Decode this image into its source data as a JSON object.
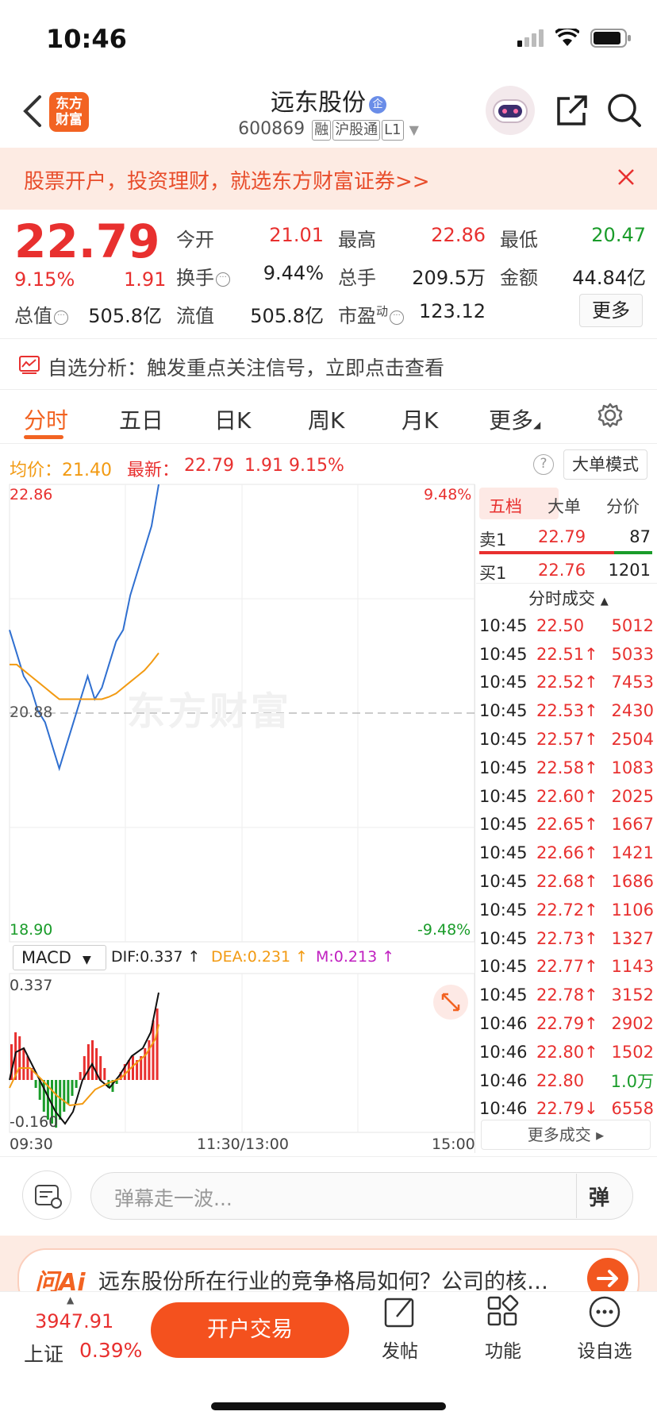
{
  "status": {
    "time": "10:46"
  },
  "header": {
    "logo_line1": "东方",
    "logo_line2": "财富",
    "title": "远东股份",
    "title_badge": "企",
    "code": "600869",
    "tags": [
      "融",
      "沪股通",
      "L1"
    ]
  },
  "banner": {
    "text": "股票开户，投资理财，就选东方财富证券>>"
  },
  "quote": {
    "price": "22.79",
    "pct": "9.15%",
    "change": "1.91",
    "open_label": "今开",
    "open": "21.01",
    "high_label": "最高",
    "high": "22.86",
    "low_label": "最低",
    "low": "20.47",
    "turnover_label": "换手",
    "turnover": "9.44%",
    "volume_label": "总手",
    "volume": "209.5万",
    "amount_label": "金额",
    "amount": "44.84亿",
    "mcap_label": "总值",
    "mcap": "505.8亿",
    "float_label": "流值",
    "float": "505.8亿",
    "pe_label": "市盈",
    "pe_sup": "动",
    "pe": "123.12",
    "more": "更多"
  },
  "analysis": {
    "text": "自选分析：触发重点关注信号，立即点击查看"
  },
  "tabs": [
    "分时",
    "五日",
    "日K",
    "周K",
    "月K",
    "更多"
  ],
  "info": {
    "avg_label": "均价：",
    "avg": "21.40",
    "latest_label": "最新：",
    "latest": "22.79",
    "change": "1.91",
    "pct": "9.15%",
    "help": "?",
    "big_mode": "大单模式"
  },
  "chart": {
    "top_price": "22.86",
    "top_pct": "9.48%",
    "mid_price": "20.88",
    "bottom_price": "18.90",
    "bottom_pct": "-9.48%",
    "watermark": "东方财富",
    "macd_select": "MACD",
    "dif": "DIF:0.337 ↑",
    "dea": "DEA:0.231 ↑",
    "m": "M:0.213 ↑",
    "macd_top": "0.337",
    "macd_bottom": "-0.160",
    "t_start": "09:30",
    "t_mid": "11:30/13:00",
    "t_end": "15:00",
    "colors": {
      "price_line": "#2f6fd0",
      "avg_line": "#f29a12",
      "up": "#e8302f",
      "down": "#1a9c2a"
    }
  },
  "chart_data": {
    "type": "line",
    "title": "",
    "series": [
      {
        "name": "",
        "values": [
          21.6,
          21.4,
          21.2,
          21.1,
          20.9,
          20.8,
          20.6,
          20.4,
          20.6,
          20.8,
          21.0,
          21.2,
          21.0,
          21.1,
          21.3,
          21.5,
          21.6,
          21.9,
          22.1,
          22.3,
          22.5,
          22.86
        ]
      },
      {
        "name": "均价",
        "values": [
          21.3,
          21.3,
          21.25,
          21.2,
          21.15,
          21.1,
          21.05,
          21.0,
          21.0,
          21.0,
          21.0,
          21.0,
          21.0,
          21.0,
          21.02,
          21.05,
          21.1,
          21.15,
          21.2,
          21.25,
          21.32,
          21.4
        ]
      }
    ],
    "ylim": [
      18.9,
      22.86
    ]
  },
  "side": {
    "tabs": [
      "五档",
      "大单",
      "分价"
    ],
    "sell_label": "卖1",
    "sell_price": "22.79",
    "sell_vol": "87",
    "buy_label": "买1",
    "buy_price": "22.76",
    "buy_vol": "1201",
    "ticks_title": "分时成交",
    "ticks": [
      {
        "t": "10:45",
        "p": "22.50",
        "v": "5012",
        "pc": "red",
        "vc": "red"
      },
      {
        "t": "10:45",
        "p": "22.51↑",
        "v": "5033",
        "pc": "red",
        "vc": "red"
      },
      {
        "t": "10:45",
        "p": "22.52↑",
        "v": "7453",
        "pc": "red",
        "vc": "red"
      },
      {
        "t": "10:45",
        "p": "22.53↑",
        "v": "2430",
        "pc": "red",
        "vc": "red"
      },
      {
        "t": "10:45",
        "p": "22.57↑",
        "v": "2504",
        "pc": "red",
        "vc": "red"
      },
      {
        "t": "10:45",
        "p": "22.58↑",
        "v": "1083",
        "pc": "red",
        "vc": "red"
      },
      {
        "t": "10:45",
        "p": "22.60↑",
        "v": "2025",
        "pc": "red",
        "vc": "red"
      },
      {
        "t": "10:45",
        "p": "22.65↑",
        "v": "1667",
        "pc": "red",
        "vc": "red"
      },
      {
        "t": "10:45",
        "p": "22.66↑",
        "v": "1421",
        "pc": "red",
        "vc": "red"
      },
      {
        "t": "10:45",
        "p": "22.68↑",
        "v": "1686",
        "pc": "red",
        "vc": "red"
      },
      {
        "t": "10:45",
        "p": "22.72↑",
        "v": "1106",
        "pc": "red",
        "vc": "red"
      },
      {
        "t": "10:45",
        "p": "22.73↑",
        "v": "1327",
        "pc": "red",
        "vc": "red"
      },
      {
        "t": "10:45",
        "p": "22.77↑",
        "v": "1143",
        "pc": "red",
        "vc": "red"
      },
      {
        "t": "10:45",
        "p": "22.78↑",
        "v": "3152",
        "pc": "red",
        "vc": "red"
      },
      {
        "t": "10:46",
        "p": "22.79↑",
        "v": "2902",
        "pc": "red",
        "vc": "red"
      },
      {
        "t": "10:46",
        "p": "22.80↑",
        "v": "1502",
        "pc": "red",
        "vc": "red"
      },
      {
        "t": "10:46",
        "p": "22.80",
        "v": "1.0万",
        "pc": "red",
        "vc": "green"
      },
      {
        "t": "10:46",
        "p": "22.79↓",
        "v": "6558",
        "pc": "red",
        "vc": "red"
      }
    ],
    "more_deals": "更多成交 ▸"
  },
  "comment": {
    "placeholder": "弹幕走一波...",
    "button": "弹"
  },
  "ai": {
    "logo": "问Ai",
    "text": "远东股份所在行业的竞争格局如何？公司的核…"
  },
  "bottom": {
    "index_value": "3947.91",
    "index_name": "上证",
    "index_pct": "0.39%",
    "trade": "开户交易",
    "post": "发帖",
    "func": "功能",
    "watch": "设自选"
  }
}
